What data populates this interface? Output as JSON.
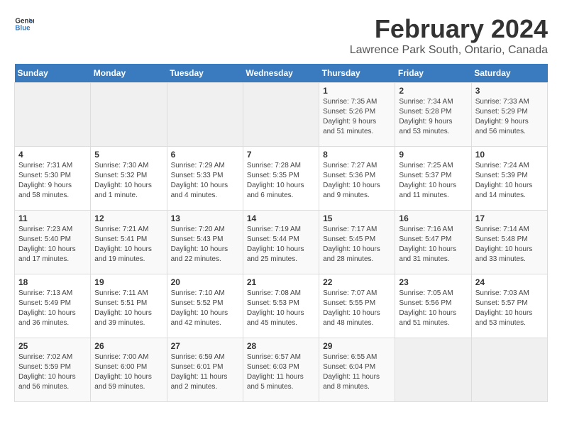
{
  "header": {
    "logo_line1": "General",
    "logo_line2": "Blue",
    "month_year": "February 2024",
    "location": "Lawrence Park South, Ontario, Canada"
  },
  "weekdays": [
    "Sunday",
    "Monday",
    "Tuesday",
    "Wednesday",
    "Thursday",
    "Friday",
    "Saturday"
  ],
  "weeks": [
    [
      {
        "day": "",
        "info": ""
      },
      {
        "day": "",
        "info": ""
      },
      {
        "day": "",
        "info": ""
      },
      {
        "day": "",
        "info": ""
      },
      {
        "day": "1",
        "info": "Sunrise: 7:35 AM\nSunset: 5:26 PM\nDaylight: 9 hours\nand 51 minutes."
      },
      {
        "day": "2",
        "info": "Sunrise: 7:34 AM\nSunset: 5:28 PM\nDaylight: 9 hours\nand 53 minutes."
      },
      {
        "day": "3",
        "info": "Sunrise: 7:33 AM\nSunset: 5:29 PM\nDaylight: 9 hours\nand 56 minutes."
      }
    ],
    [
      {
        "day": "4",
        "info": "Sunrise: 7:31 AM\nSunset: 5:30 PM\nDaylight: 9 hours\nand 58 minutes."
      },
      {
        "day": "5",
        "info": "Sunrise: 7:30 AM\nSunset: 5:32 PM\nDaylight: 10 hours\nand 1 minute."
      },
      {
        "day": "6",
        "info": "Sunrise: 7:29 AM\nSunset: 5:33 PM\nDaylight: 10 hours\nand 4 minutes."
      },
      {
        "day": "7",
        "info": "Sunrise: 7:28 AM\nSunset: 5:35 PM\nDaylight: 10 hours\nand 6 minutes."
      },
      {
        "day": "8",
        "info": "Sunrise: 7:27 AM\nSunset: 5:36 PM\nDaylight: 10 hours\nand 9 minutes."
      },
      {
        "day": "9",
        "info": "Sunrise: 7:25 AM\nSunset: 5:37 PM\nDaylight: 10 hours\nand 11 minutes."
      },
      {
        "day": "10",
        "info": "Sunrise: 7:24 AM\nSunset: 5:39 PM\nDaylight: 10 hours\nand 14 minutes."
      }
    ],
    [
      {
        "day": "11",
        "info": "Sunrise: 7:23 AM\nSunset: 5:40 PM\nDaylight: 10 hours\nand 17 minutes."
      },
      {
        "day": "12",
        "info": "Sunrise: 7:21 AM\nSunset: 5:41 PM\nDaylight: 10 hours\nand 19 minutes."
      },
      {
        "day": "13",
        "info": "Sunrise: 7:20 AM\nSunset: 5:43 PM\nDaylight: 10 hours\nand 22 minutes."
      },
      {
        "day": "14",
        "info": "Sunrise: 7:19 AM\nSunset: 5:44 PM\nDaylight: 10 hours\nand 25 minutes."
      },
      {
        "day": "15",
        "info": "Sunrise: 7:17 AM\nSunset: 5:45 PM\nDaylight: 10 hours\nand 28 minutes."
      },
      {
        "day": "16",
        "info": "Sunrise: 7:16 AM\nSunset: 5:47 PM\nDaylight: 10 hours\nand 31 minutes."
      },
      {
        "day": "17",
        "info": "Sunrise: 7:14 AM\nSunset: 5:48 PM\nDaylight: 10 hours\nand 33 minutes."
      }
    ],
    [
      {
        "day": "18",
        "info": "Sunrise: 7:13 AM\nSunset: 5:49 PM\nDaylight: 10 hours\nand 36 minutes."
      },
      {
        "day": "19",
        "info": "Sunrise: 7:11 AM\nSunset: 5:51 PM\nDaylight: 10 hours\nand 39 minutes."
      },
      {
        "day": "20",
        "info": "Sunrise: 7:10 AM\nSunset: 5:52 PM\nDaylight: 10 hours\nand 42 minutes."
      },
      {
        "day": "21",
        "info": "Sunrise: 7:08 AM\nSunset: 5:53 PM\nDaylight: 10 hours\nand 45 minutes."
      },
      {
        "day": "22",
        "info": "Sunrise: 7:07 AM\nSunset: 5:55 PM\nDaylight: 10 hours\nand 48 minutes."
      },
      {
        "day": "23",
        "info": "Sunrise: 7:05 AM\nSunset: 5:56 PM\nDaylight: 10 hours\nand 51 minutes."
      },
      {
        "day": "24",
        "info": "Sunrise: 7:03 AM\nSunset: 5:57 PM\nDaylight: 10 hours\nand 53 minutes."
      }
    ],
    [
      {
        "day": "25",
        "info": "Sunrise: 7:02 AM\nSunset: 5:59 PM\nDaylight: 10 hours\nand 56 minutes."
      },
      {
        "day": "26",
        "info": "Sunrise: 7:00 AM\nSunset: 6:00 PM\nDaylight: 10 hours\nand 59 minutes."
      },
      {
        "day": "27",
        "info": "Sunrise: 6:59 AM\nSunset: 6:01 PM\nDaylight: 11 hours\nand 2 minutes."
      },
      {
        "day": "28",
        "info": "Sunrise: 6:57 AM\nSunset: 6:03 PM\nDaylight: 11 hours\nand 5 minutes."
      },
      {
        "day": "29",
        "info": "Sunrise: 6:55 AM\nSunset: 6:04 PM\nDaylight: 11 hours\nand 8 minutes."
      },
      {
        "day": "",
        "info": ""
      },
      {
        "day": "",
        "info": ""
      }
    ]
  ]
}
